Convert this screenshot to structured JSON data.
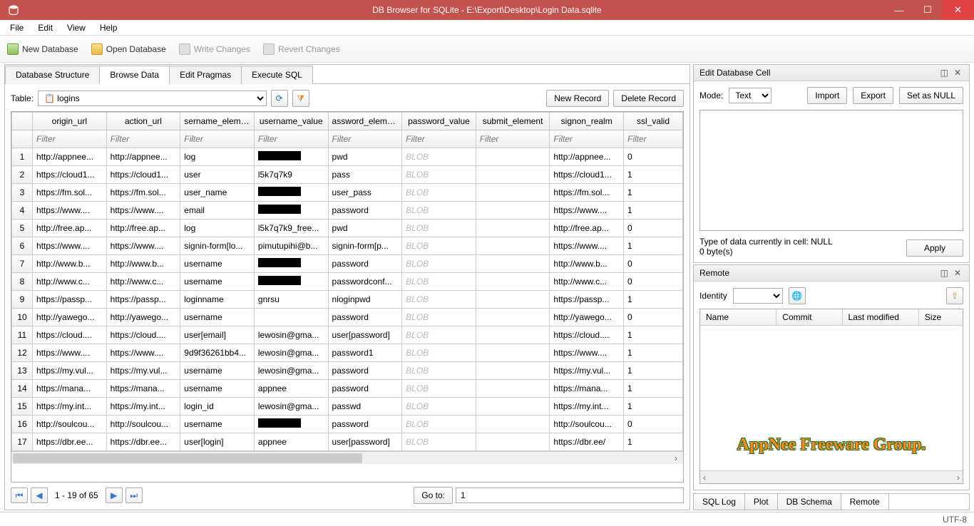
{
  "titlebar": {
    "title": "DB Browser for SQLite - E:\\Export\\Desktop\\Login Data.sqlite"
  },
  "menu": {
    "file": "File",
    "edit": "Edit",
    "view": "View",
    "help": "Help"
  },
  "toolbar": {
    "newdb": "New Database",
    "opendb": "Open Database",
    "write": "Write Changes",
    "revert": "Revert Changes"
  },
  "tabs": {
    "structure": "Database Structure",
    "browse": "Browse Data",
    "pragmas": "Edit Pragmas",
    "sql": "Execute SQL"
  },
  "browse": {
    "tableLabel": "Table:",
    "tableName": "logins",
    "newRecord": "New Record",
    "deleteRecord": "Delete Record",
    "headers": [
      "origin_url",
      "action_url",
      "sername_element",
      "username_value",
      "assword_element",
      "password_value",
      "submit_element",
      "signon_realm",
      "ssl_valid"
    ],
    "filterPlaceholder": "Filter",
    "rows": [
      {
        "n": 1,
        "c": [
          "http://appnee...",
          "http://appnee...",
          "log",
          "[REDACTED]",
          "pwd",
          "BLOB",
          "",
          "http://appnee...",
          "0"
        ]
      },
      {
        "n": 2,
        "c": [
          "https://cloud1...",
          "https://cloud1...",
          "user",
          "l5k7q7k9",
          "pass",
          "BLOB",
          "",
          "https://cloud1...",
          "1"
        ]
      },
      {
        "n": 3,
        "c": [
          "https://fm.sol...",
          "https://fm.sol...",
          "user_name",
          "[REDACTED]",
          "user_pass",
          "BLOB",
          "",
          "https://fm.sol...",
          "1"
        ]
      },
      {
        "n": 4,
        "c": [
          "https://www....",
          "https://www....",
          "email",
          "[REDACTED]",
          "password",
          "BLOB",
          "",
          "https://www....",
          "1"
        ]
      },
      {
        "n": 5,
        "c": [
          "http://free.ap...",
          "http://free.ap...",
          "log",
          "l5k7q7k9_free...",
          "pwd",
          "BLOB",
          "",
          "http://free.ap...",
          "0"
        ]
      },
      {
        "n": 6,
        "c": [
          "https://www....",
          "https://www....",
          "signin-form[lo...",
          "pimutupihi@b...",
          "signin-form[p...",
          "BLOB",
          "",
          "https://www....",
          "1"
        ]
      },
      {
        "n": 7,
        "c": [
          "http://www.b...",
          "http://www.b...",
          "username",
          "[REDACTED]",
          "password",
          "BLOB",
          "",
          "http://www.b...",
          "0"
        ]
      },
      {
        "n": 8,
        "c": [
          "http://www.c...",
          "http://www.c...",
          "username",
          "[REDACTED]",
          "passwordconf...",
          "BLOB",
          "",
          "http://www.c...",
          "0"
        ]
      },
      {
        "n": 9,
        "c": [
          "https://passp...",
          "https://passp...",
          "loginname",
          "gnrsu",
          "nloginpwd",
          "BLOB",
          "",
          "https://passp...",
          "1"
        ]
      },
      {
        "n": 10,
        "c": [
          "http://yawego...",
          "http://yawego...",
          "username",
          "",
          "password",
          "BLOB",
          "",
          "http://yawego...",
          "0"
        ]
      },
      {
        "n": 11,
        "c": [
          "https://cloud....",
          "https://cloud....",
          "user[email]",
          "lewosin@gma...",
          "user[password]",
          "BLOB",
          "",
          "https://cloud....",
          "1"
        ]
      },
      {
        "n": 12,
        "c": [
          "https://www....",
          "https://www....",
          "9d9f36261bb4...",
          "lewosin@gma...",
          "password1",
          "BLOB",
          "",
          "https://www....",
          "1"
        ]
      },
      {
        "n": 13,
        "c": [
          "https://my.vul...",
          "https://my.vul...",
          "username",
          "lewosin@gma...",
          "password",
          "BLOB",
          "",
          "https://my.vul...",
          "1"
        ]
      },
      {
        "n": 14,
        "c": [
          "https://mana...",
          "https://mana...",
          "username",
          "appnee",
          "password",
          "BLOB",
          "",
          "https://mana...",
          "1"
        ]
      },
      {
        "n": 15,
        "c": [
          "https://my.int...",
          "https://my.int...",
          "login_id",
          "lewosin@gma...",
          "passwd",
          "BLOB",
          "",
          "https://my.int...",
          "1"
        ]
      },
      {
        "n": 16,
        "c": [
          "http://soulcou...",
          "http://soulcou...",
          "username",
          "[REDACTED]",
          "password",
          "BLOB",
          "",
          "http://soulcou...",
          "0"
        ]
      },
      {
        "n": 17,
        "c": [
          "https://dbr.ee...",
          "https://dbr.ee...",
          "user[login]",
          "appnee",
          "user[password]",
          "BLOB",
          "",
          "https://dbr.ee/",
          "1"
        ]
      }
    ],
    "pagerText": "1 - 19 of 65",
    "gotoLabel": "Go to:",
    "gotoValue": "1"
  },
  "editcell": {
    "title": "Edit Database Cell",
    "modeLabel": "Mode:",
    "modeValue": "Text",
    "import": "Import",
    "export": "Export",
    "setnull": "Set as NULL",
    "typeInfo": "Type of data currently in cell: NULL",
    "sizeInfo": "0 byte(s)",
    "apply": "Apply"
  },
  "remote": {
    "title": "Remote",
    "identityLabel": "Identity",
    "cols": {
      "name": "Name",
      "commit": "Commit",
      "lastmod": "Last modified",
      "size": "Size"
    },
    "watermark": "AppNee Freeware Group."
  },
  "bottomtabs": {
    "sqllog": "SQL Log",
    "plot": "Plot",
    "dbschema": "DB Schema",
    "remote": "Remote"
  },
  "status": {
    "encoding": "UTF-8"
  }
}
